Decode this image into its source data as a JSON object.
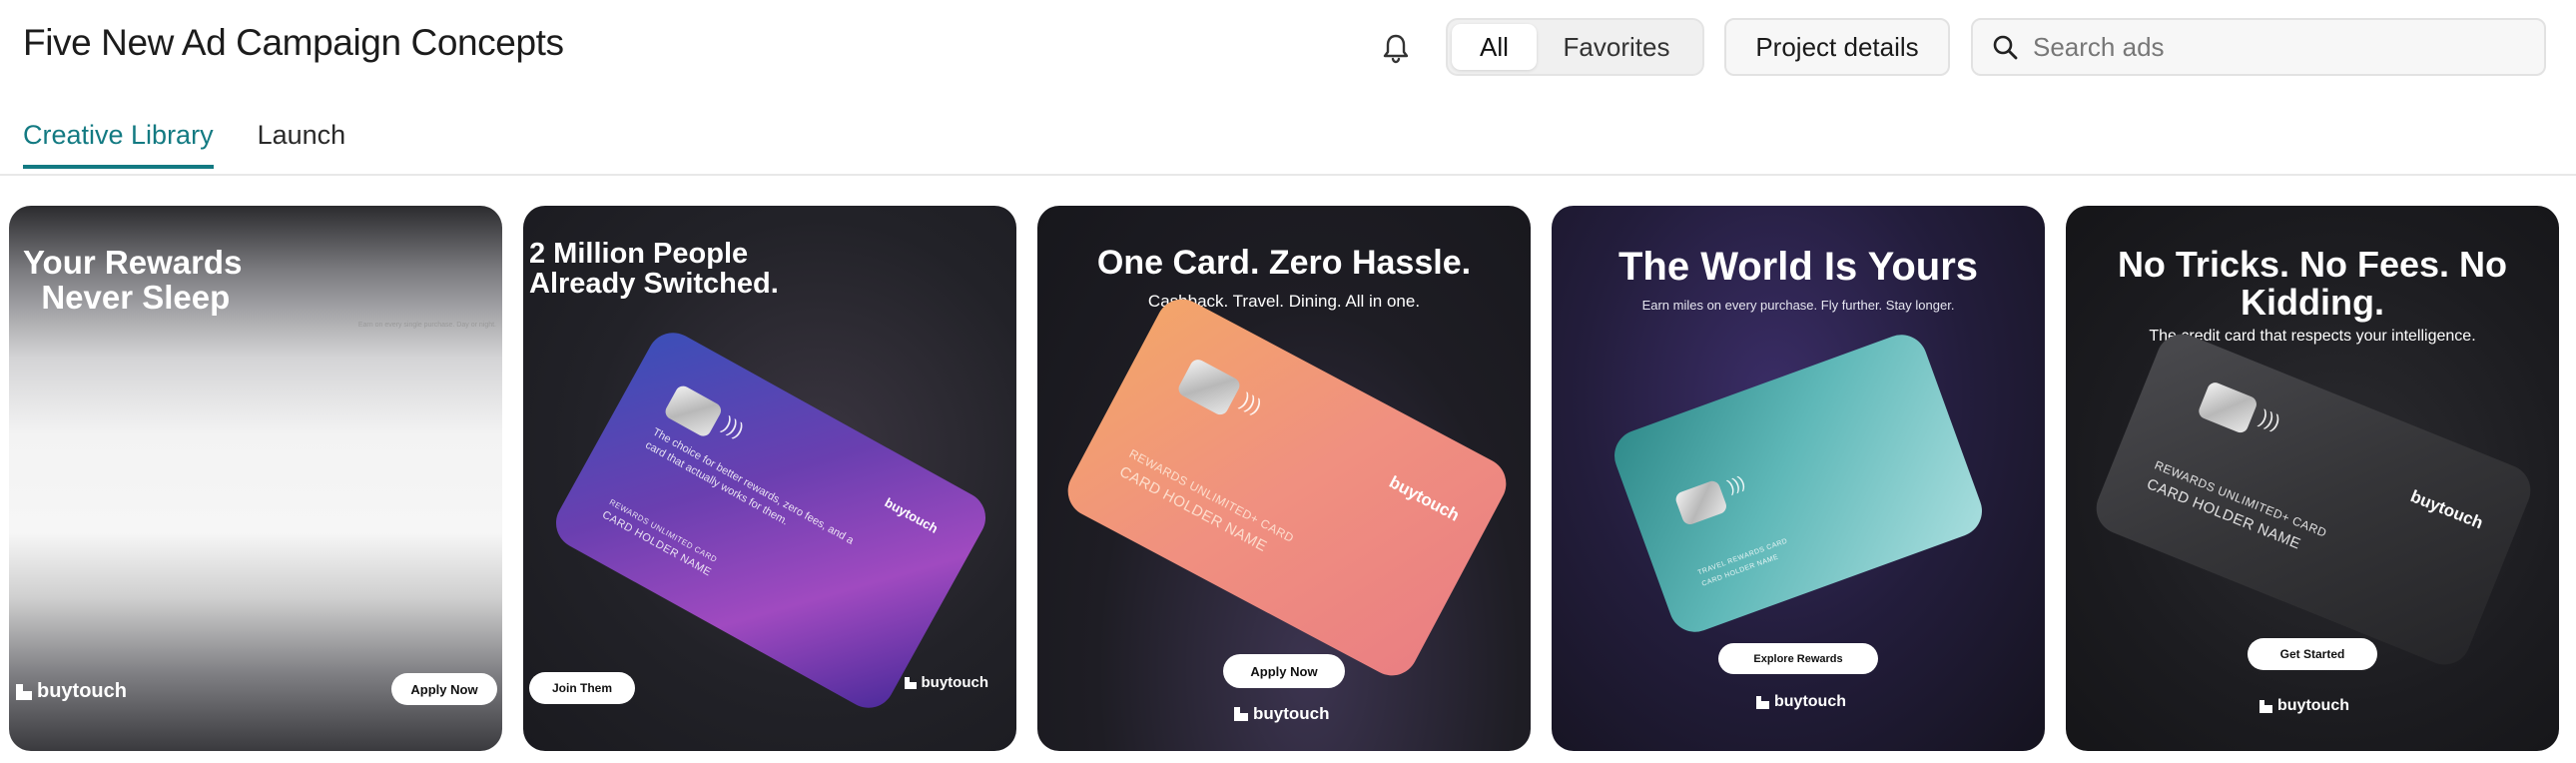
{
  "header": {
    "title": "Five New Ad Campaign Concepts",
    "filter": {
      "all_label": "All",
      "favorites_label": "Favorites"
    },
    "project_details_label": "Project details",
    "search_placeholder": "Search ads"
  },
  "tabs": [
    {
      "label": "Creative Library",
      "active": true
    },
    {
      "label": "Launch",
      "active": false
    }
  ],
  "accent_color": "#137a82",
  "ads": [
    {
      "headline": "Your Rewards\n  Never Sleep",
      "subtext": "Earn on every single purchase. Day or night.",
      "cta": "Apply Now",
      "brand": "buytouch"
    },
    {
      "headline": "2 Million People Already Switched.",
      "subtext": "The choice for better rewards, zero fees, and a card that actually works for them.",
      "card_brand": "buytouch",
      "card_line1": "REWARDS UNLIMITED CARD",
      "card_line2": "CARD HOLDER NAME",
      "cta": "Join Them",
      "brand": "buytouch"
    },
    {
      "headline": "One Card. Zero Hassle.",
      "subtext": "Cashback. Travel. Dining. All in one.",
      "card_brand": "buytouch",
      "card_line1": "REWARDS UNLIMITED+ CARD",
      "card_line2": "CARD HOLDER NAME",
      "cta": "Apply Now",
      "brand": "buytouch"
    },
    {
      "headline": "The World Is Yours",
      "subtext": "Earn miles on every purchase. Fly further. Stay longer.",
      "card_line1": "TRAVEL REWARDS CARD",
      "card_line2": "CARD HOLDER NAME",
      "cta": "Explore Rewards",
      "brand": "buytouch"
    },
    {
      "headline": "No Tricks. No Fees. No Kidding.",
      "subtext": "The credit card that respects your intelligence.",
      "card_brand": "buytouch",
      "card_line1": "REWARDS UNLIMITED+ CARD",
      "card_line2": "CARD HOLDER NAME",
      "cta": "Get Started",
      "brand": "buytouch"
    }
  ]
}
